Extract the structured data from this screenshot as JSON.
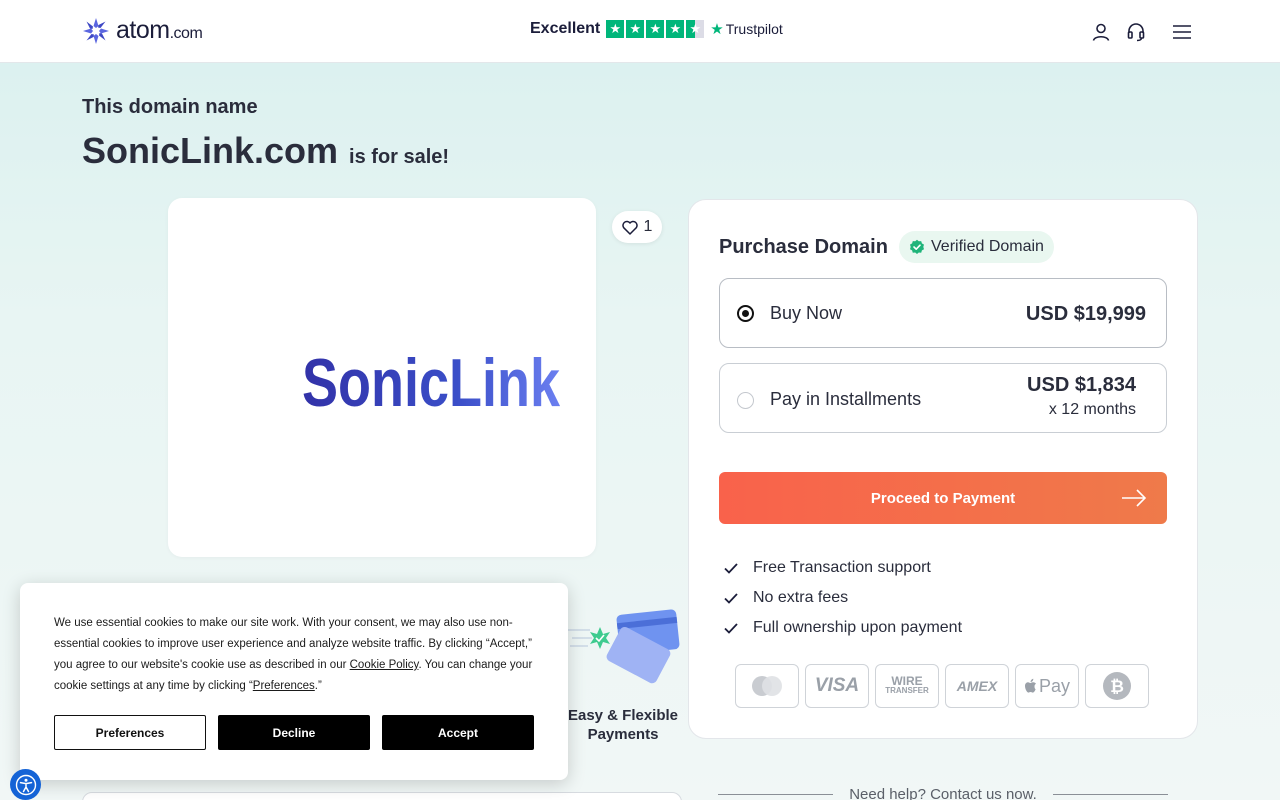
{
  "header": {
    "brand": "atom",
    "brand_tld": ".com",
    "trust_rating_word": "Excellent",
    "trust_brand": "Trustpilot",
    "trust_stars": 4.5,
    "icons": [
      "user-icon",
      "headset-icon",
      "menu-icon"
    ]
  },
  "hero": {
    "eyebrow": "This domain name",
    "domain": "SonicLink.com",
    "suffix": "is for sale!"
  },
  "listing": {
    "brand_logo_text": "SonicLink",
    "likes": "1"
  },
  "purchase": {
    "title": "Purchase Domain",
    "verified_label": "Verified Domain",
    "options": [
      {
        "label": "Buy Now",
        "price": "USD $19,999",
        "selected": true
      },
      {
        "label": "Pay in Installments",
        "price": "USD $1,834",
        "term": "x 12 months",
        "selected": false
      }
    ],
    "cta": "Proceed to Payment",
    "features": [
      "Free Transaction support",
      "No extra fees",
      "Full ownership upon payment"
    ],
    "payment_methods": [
      "mastercard",
      "VISA",
      "WIRE TRANSFER",
      "AMEX",
      "Pay",
      "bitcoin"
    ]
  },
  "easy_payments": {
    "label_line1": "Easy & Flexible",
    "label_line2": "Payments"
  },
  "help": {
    "text": "Need help? Contact us now."
  },
  "cookie": {
    "text_1": "We use essential cookies to make our site work. With your consent, we may also use non-essential cookies to improve user experience and analyze website traffic. By clicking “Accept,” you agree to our website's cookie use as described in our ",
    "policy_link": "Cookie Policy",
    "text_2": ". You can change your cookie settings at any time by clicking “",
    "prefs_link": "Preferences",
    "text_3": ".”",
    "buttons": {
      "preferences": "Preferences",
      "decline": "Decline",
      "accept": "Accept"
    }
  },
  "colors": {
    "accent": "#f9624b",
    "trustpilot_green": "#00b67a",
    "brand_blue": "#4b56d2",
    "verified_green": "#1fb47a"
  }
}
